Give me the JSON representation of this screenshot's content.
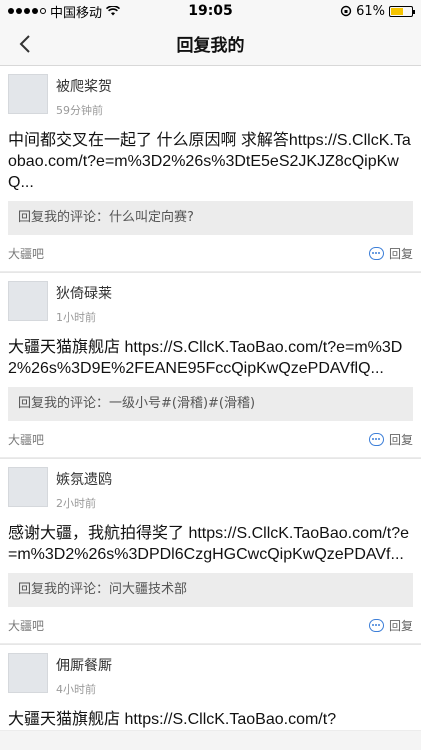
{
  "status": {
    "carrier": "中国移动",
    "time": "19:05",
    "battery": "61%",
    "battery_level": 0.61,
    "accent": "#f5c400"
  },
  "nav": {
    "title": "回复我的"
  },
  "items": [
    {
      "username": "被爬桨贺",
      "time": "59分钟前",
      "content": "中间都交叉在一起了 什么原因啊 求解答https://S.CllcK.Taobao.com/t?e=m%3D2%26s%3DtE5eS2JKJZ8cQipKwQ...",
      "quote": "回复我的评论：什么叫定向赛?",
      "forum": "大疆吧",
      "reply_label": "回复"
    },
    {
      "username": "狄倚碌莱",
      "time": "1小时前",
      "content": "大疆天猫旗舰店 https://S.CllcK.TaoBao.com/t?e=m%3D2%26s%3D9E%2FEANE95FccQipKwQzePDAVflQ...",
      "quote": "回复我的评论：一级小号#(滑稽)#(滑稽)",
      "forum": "大疆吧",
      "reply_label": "回复"
    },
    {
      "username": "嫉氛遗鸥",
      "time": "2小时前",
      "content": "感谢大疆，我航拍得奖了 https://S.CllcK.TaoBao.com/t?e=m%3D2%26s%3DPDl6CzgHGCwcQipKwQzePDAVf...",
      "quote": "回复我的评论：问大疆技术部",
      "forum": "大疆吧",
      "reply_label": "回复"
    },
    {
      "username": "佣厮餐厮",
      "time": "4小时前",
      "content": "大疆天猫旗舰店 https://S.CllcK.TaoBao.com/t?",
      "quote": "",
      "forum": "",
      "reply_label": ""
    }
  ]
}
